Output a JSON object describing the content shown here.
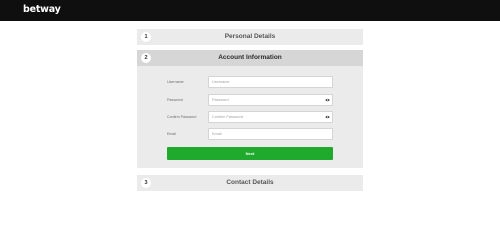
{
  "brand": {
    "logo_text": "betway",
    "header_color": "#0f0f0f"
  },
  "steps": [
    {
      "number": "1",
      "title": "Personal Details",
      "state": "collapsed"
    },
    {
      "number": "2",
      "title": "Account Information",
      "state": "active"
    },
    {
      "number": "3",
      "title": "Contact Details",
      "state": "collapsed"
    }
  ],
  "form": {
    "username": {
      "label": "Username",
      "placeholder": "Username",
      "value": ""
    },
    "password": {
      "label": "Password",
      "placeholder": "Password",
      "value": "",
      "icon": "eye-icon"
    },
    "confirm_password": {
      "label": "Confirm Password",
      "placeholder": "Confirm Password",
      "value": "",
      "icon": "eye-icon"
    },
    "email": {
      "label": "Email",
      "placeholder": "Email",
      "value": ""
    }
  },
  "next_button": {
    "label": "Next",
    "color": "#1faa2e"
  }
}
